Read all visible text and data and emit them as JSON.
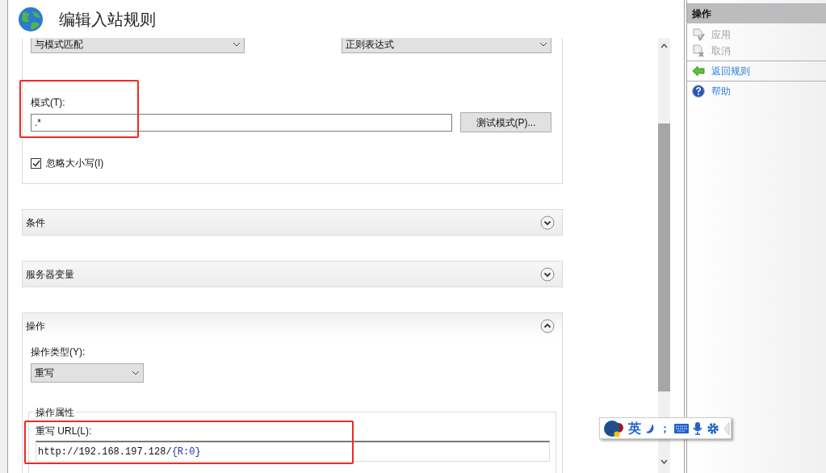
{
  "window": {
    "title": "编辑入站规则"
  },
  "match": {
    "using": "与模式匹配",
    "syntax": "正则表达式",
    "pattern_label": "模式(T):",
    "pattern_value": ".*",
    "test_button": "测试模式(P)...",
    "ignore_case": {
      "label": "忽略大小写(I)",
      "checked": true
    }
  },
  "sections": [
    {
      "title": "条件",
      "expanded": false
    },
    {
      "title": "服务器变量",
      "expanded": false
    },
    {
      "title": "操作",
      "expanded": true
    }
  ],
  "action": {
    "type_label": "操作类型(Y):",
    "type_value": "重写",
    "group_title": "操作属性",
    "url_label": "重写 URL(L):",
    "url_parts": [
      {
        "text": "http://192.168.197.128/",
        "kind": "literal"
      },
      {
        "text": "{R:0}",
        "kind": "token"
      }
    ]
  },
  "actions_pane": {
    "title": "操作",
    "items": [
      {
        "label": "应用",
        "kind": "apply",
        "disabled": true
      },
      {
        "label": "取消",
        "kind": "cancel",
        "disabled": true
      },
      {
        "label": "返回规则",
        "kind": "back",
        "disabled": false
      },
      {
        "label": "帮助",
        "kind": "help",
        "disabled": false
      }
    ]
  },
  "ime_bar": {
    "mode": "英",
    "punct": "；"
  }
}
